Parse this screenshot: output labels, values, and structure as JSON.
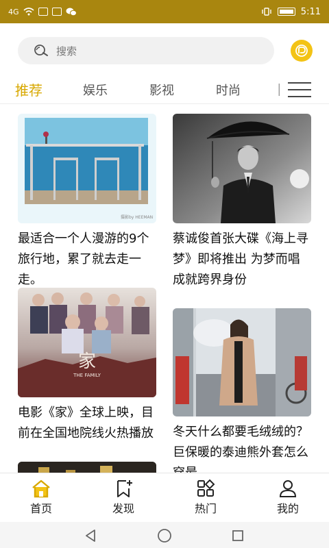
{
  "status_bar": {
    "network": "4G",
    "time": "5:11"
  },
  "search": {
    "placeholder": "搜索"
  },
  "tabs": [
    {
      "label": "推荐",
      "active": true
    },
    {
      "label": "娱乐",
      "active": false
    },
    {
      "label": "影视",
      "active": false
    },
    {
      "label": "时尚",
      "active": false
    }
  ],
  "feed": {
    "cards": [
      {
        "title": "最适合一个人漫游的9个旅行地，累了就去走一走。",
        "image": "seaside-table-photo",
        "watermark": "摄影by HEEMAN"
      },
      {
        "title": "蔡诚俊首张大碟《海上寻梦》即将推出 为梦而唱成就跨界身份",
        "image": "man-with-umbrella-photo"
      },
      {
        "title": "电影《家》全球上映，目前在全国地院线火热播放",
        "image": "the-family-poster",
        "poster_title": "家",
        "poster_subtitle": "THE FAMILY"
      },
      {
        "title": "冬天什么都要毛绒绒的？巨保暖的泰迪熊外套怎么穿最",
        "image": "teddy-coat-street-photo"
      }
    ]
  },
  "bottom_nav": [
    {
      "label": "首页",
      "icon": "home-icon",
      "active": true
    },
    {
      "label": "发现",
      "icon": "bookmark-icon",
      "active": false
    },
    {
      "label": "热门",
      "icon": "grid-icon",
      "active": false
    },
    {
      "label": "我的",
      "icon": "user-icon",
      "active": false
    }
  ],
  "colors": {
    "accent": "#d8a800",
    "status_bar": "#a9860f",
    "logo": "#f3c315"
  }
}
